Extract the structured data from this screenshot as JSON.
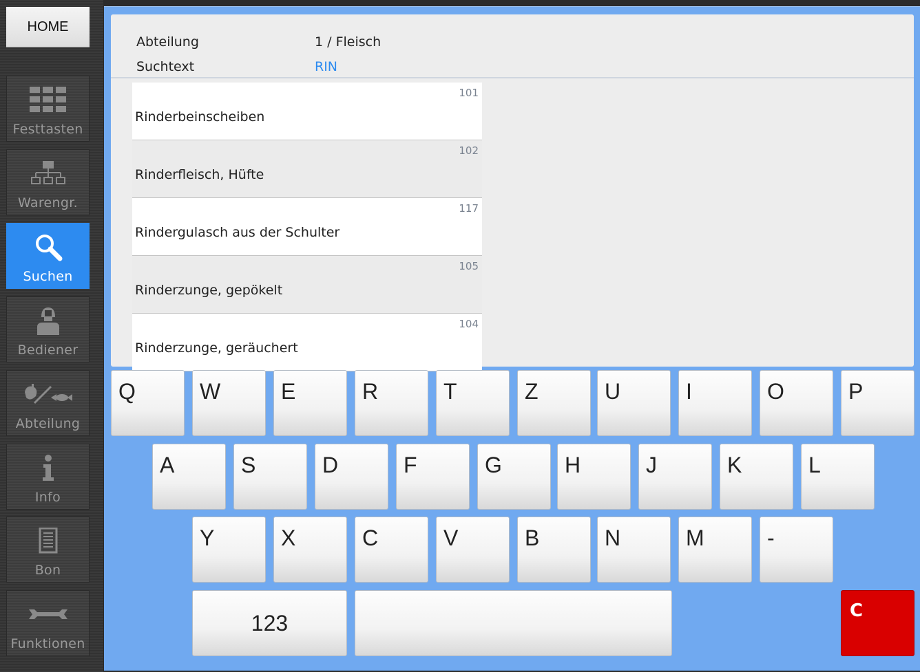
{
  "sidebar": {
    "home_label": "HOME",
    "items": [
      {
        "label": "Festtasten",
        "icon": "grid-icon"
      },
      {
        "label": "Warengr.",
        "icon": "hierarchy-icon"
      },
      {
        "label": "Suchen",
        "icon": "search-icon",
        "active": true
      },
      {
        "label": "Bediener",
        "icon": "operator-icon"
      },
      {
        "label": "Abteilung",
        "icon": "department-icon"
      },
      {
        "label": "Info",
        "icon": "info-icon"
      },
      {
        "label": "Bon",
        "icon": "receipt-icon"
      },
      {
        "label": "Funktionen",
        "icon": "wrench-icon"
      }
    ]
  },
  "info": {
    "department_label": "Abteilung",
    "department_value": "1 / Fleisch",
    "search_label": "Suchtext",
    "search_value": "RIN",
    "search_value_color": "#2d8bf0"
  },
  "results": [
    {
      "code": "101",
      "name": "Rinderbeinscheiben"
    },
    {
      "code": "102",
      "name": "Rinderfleisch, Hüfte"
    },
    {
      "code": "117",
      "name": "Rindergulasch aus der Schulter"
    },
    {
      "code": "105",
      "name": "Rinderzunge, gepökelt"
    },
    {
      "code": "104",
      "name": "Rinderzunge, geräuchert"
    }
  ],
  "keyboard": {
    "row1": [
      "Q",
      "W",
      "E",
      "R",
      "T",
      "Z",
      "U",
      "I",
      "O",
      "P"
    ],
    "row2": [
      "A",
      "S",
      "D",
      "F",
      "G",
      "H",
      "J",
      "K",
      "L"
    ],
    "row3": [
      "Y",
      "X",
      "C",
      "V",
      "B",
      "N",
      "M",
      "-"
    ],
    "numeric_label": "123",
    "space_label": "",
    "clear_label": "C",
    "clear_color": "#d90000"
  },
  "colors": {
    "accent": "#2d8bf0",
    "panel_background": "#70a9f0"
  }
}
